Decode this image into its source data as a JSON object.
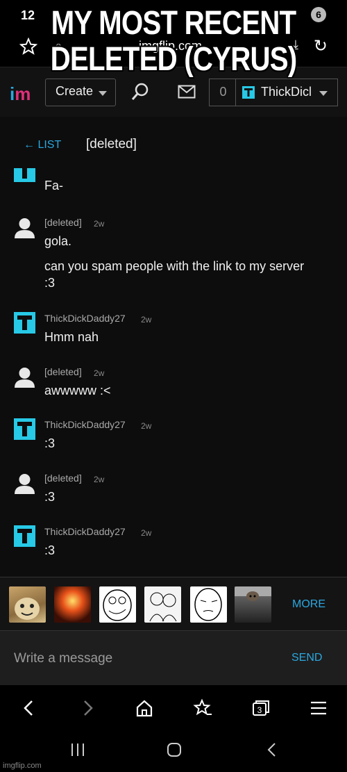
{
  "caption": {
    "line1": "MY MOST RECENT",
    "line2": "DELETED (CYRUS)"
  },
  "statusbar": {
    "time": "12",
    "badge": "6"
  },
  "browser": {
    "url": "imgflip.com"
  },
  "header": {
    "logo_i": "i",
    "logo_m": "m",
    "create_label": "Create",
    "notification_count": "0",
    "username": "ThickDicl"
  },
  "thread": {
    "back_label": "← LIST",
    "title": "[deleted]"
  },
  "messages": [
    {
      "author": "",
      "time": "",
      "lines": [
        "Fa-"
      ],
      "avatar": "t-icon"
    },
    {
      "author": "[deleted]",
      "time": "2w",
      "lines": [
        "gola.",
        "can you spam people with the link to my server",
        ":3"
      ],
      "avatar": "person-icon"
    },
    {
      "author": "ThickDickDaddy27",
      "time": "2w",
      "lines": [
        "Hmm nah"
      ],
      "avatar": "t-icon"
    },
    {
      "author": "[deleted]",
      "time": "2w",
      "lines": [
        "awwwww :<"
      ],
      "avatar": "person-icon"
    },
    {
      "author": "ThickDickDaddy27",
      "time": "2w",
      "lines": [
        ":3"
      ],
      "avatar": "t-icon"
    },
    {
      "author": "[deleted]",
      "time": "2w",
      "lines": [
        ":3"
      ],
      "avatar": "person-icon"
    },
    {
      "author": "ThickDickDaddy27",
      "time": "2w",
      "lines": [
        ":3"
      ],
      "avatar": "t-icon"
    }
  ],
  "strip": {
    "more_label": "MORE"
  },
  "compose": {
    "placeholder": "Write a message",
    "send_label": "SEND"
  },
  "watermark": "imgflip.com",
  "colors": {
    "accent": "#2aa8e0",
    "teal_avatar": "#27c9e6",
    "background": "#0d0d0d"
  }
}
